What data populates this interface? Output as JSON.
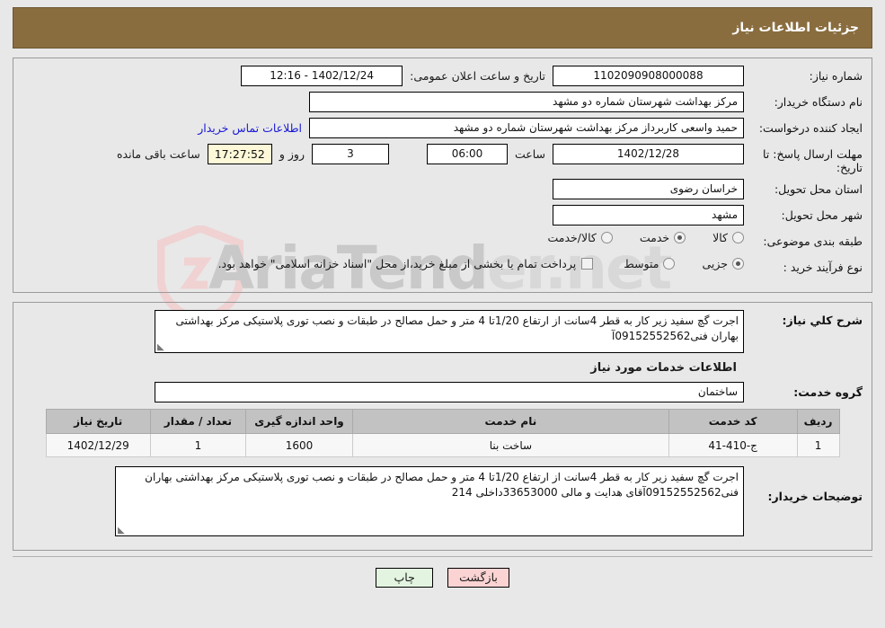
{
  "header": {
    "title": "جزئیات اطلاعات نیاز",
    "bar_color": "#8a6d3f"
  },
  "watermark": {
    "brand": "AriaTend",
    "suffix": "er.net",
    "top_text": "AriaTender"
  },
  "info": {
    "need_number_label": "شماره نیاز:",
    "need_number_value": "1102090908000088",
    "announce_label": "تاریخ و ساعت اعلان عمومی:",
    "announce_value": "12:16 - 1402/12/24",
    "buyer_org_label": "نام دستگاه خریدار:",
    "buyer_org_value": "مرکز بهداشت شهرستان شماره دو مشهد",
    "requester_label": "ایجاد کننده درخواست:",
    "requester_value": "حمید واسعی کاربرداز مرکز بهداشت شهرستان شماره دو مشهد",
    "contact_link": "اطلاعات تماس خریدار",
    "deadline_label": "مهلت ارسال پاسخ: تا تاریخ:",
    "deadline_date": "1402/12/28",
    "hour_label": "ساعت",
    "deadline_time": "06:00",
    "days_value": "3",
    "days_label": "روز و",
    "countdown": "17:27:52",
    "remaining_label": "ساعت باقی مانده",
    "province_label": "استان محل تحویل:",
    "province_value": "خراسان رضوی",
    "city_label": "شهر محل تحویل:",
    "city_value": "مشهد"
  },
  "classification": {
    "label": "طبقه بندی موضوعی:",
    "options": [
      {
        "label": "کالا",
        "selected": false
      },
      {
        "label": "خدمت",
        "selected": true
      },
      {
        "label": "کالا/خدمت",
        "selected": false
      }
    ]
  },
  "process": {
    "label": "نوع فرآیند خرید :",
    "options": [
      {
        "label": "جزیی",
        "selected": true
      },
      {
        "label": "متوسط",
        "selected": false
      }
    ],
    "checkbox_checked": false,
    "checkbox_note": "پرداخت تمام یا بخشی از مبلغ خرید،از محل \"اسناد خزانه اسلامی\" خواهد بود."
  },
  "summary": {
    "label": "شرح کلي نیاز:",
    "value": "اجرت گچ سفید زیر کار به قطر 4سانت  از ارتفاع 1/20تا 4 متر و حمل مصالح در طبقات و نصب توری پلاستیکی  مرکز بهداشتی بهاران  فنی09152552562آ"
  },
  "services": {
    "section_title": "اطلاعات خدمات مورد نیاز",
    "group_label": "گروه خدمت:",
    "group_value": "ساختمان",
    "columns": [
      "ردیف",
      "کد خدمت",
      "نام خدمت",
      "واحد اندازه گیری",
      "تعداد / مقدار",
      "تاریخ نیاز"
    ],
    "rows": [
      {
        "index": "1",
        "code": "ج-410-41",
        "name": "ساخت بنا",
        "unit": "1600",
        "quantity": "1",
        "need_date": "1402/12/29"
      }
    ]
  },
  "buyer_notes": {
    "label": "توضیحات خریدار:",
    "value": "اجرت گچ سفید زیر کار به قطر 4سانت  از ارتفاع 1/20تا 4 متر و حمل مصالح در طبقات و نصب توری پلاستیکی  مرکز بهداشتی بهاران  فنی09152552562آقای هدایت و مالی 33653000داخلی 214"
  },
  "buttons": {
    "back": "بازگشت",
    "print": "چاپ"
  }
}
